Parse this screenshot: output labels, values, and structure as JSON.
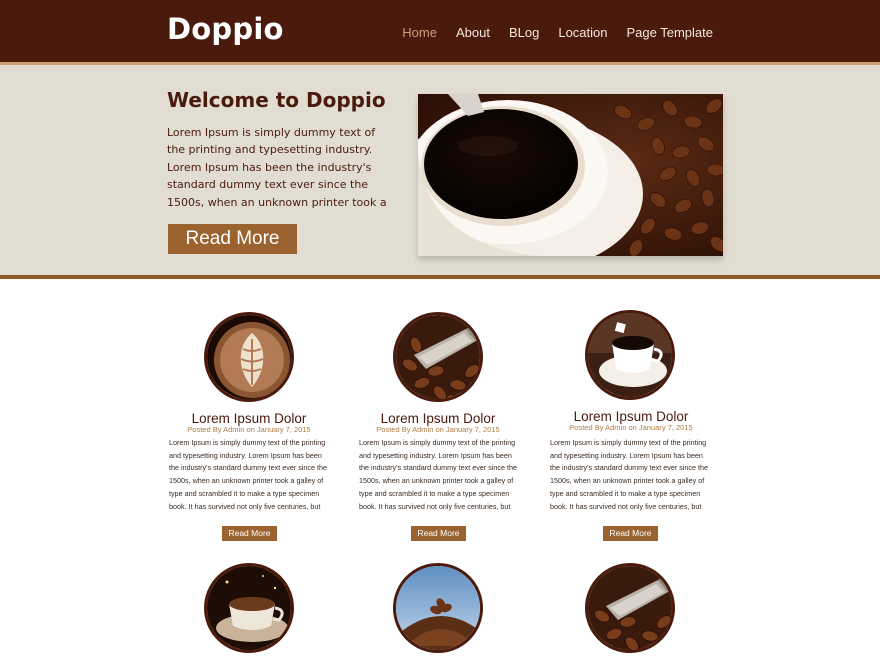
{
  "header": {
    "logo": "Doppio",
    "nav": [
      "Home",
      "About",
      "BLog",
      "Location",
      "Page Template"
    ]
  },
  "hero": {
    "title": "Welcome to Doppio",
    "text": "Lorem Ipsum is simply dummy text of the printing and typesetting industry. Lorem Ipsum has been the industry's standard dummy text ever since the 1500s, when an unknown printer took a galley of type and",
    "button": "Read More"
  },
  "cards": [
    {
      "title": "Lorem Ipsum Dolor",
      "meta": "Posted By Admin on January 7, 2015",
      "text": "Lorem Ipsum is simply dummy text of the printing and typesetting industry. Lorem Ipsum has been the industry's standard dummy text ever since the 1500s, when an unknown printer took a galley of type and scrambled it to make a type specimen book. It has survived not only five centuries, but also the leap into",
      "button": "Read More"
    },
    {
      "title": "Lorem Ipsum Dolor",
      "meta": "Posted By Admin on January 7, 2015",
      "text": "Lorem Ipsum is simply dummy text of the printing and typesetting industry. Lorem Ipsum has been the industry's standard dummy text ever since the 1500s, when an unknown printer took a galley of type and scrambled it to make a type specimen book. It has survived not only five centuries, but also",
      "button": "Read More"
    },
    {
      "title": "Lorem Ipsum Dolor",
      "meta": "Posted By Admin on January 7, 2015",
      "text": "Lorem Ipsum is simply dummy text of the printing and typesetting industry. Lorem Ipsum has been the industry's standard dummy text ever since the 1500s, when an unknown printer took a galley of type and scrambled it to make a type specimen book. It has survived not only five centuries, but also the leap into",
      "button": "Read More"
    }
  ],
  "colors": {
    "header_bg": "#4a1a0c",
    "hero_bg": "#e2ddd3",
    "accent": "#9a6330",
    "nav_active": "#c99f7d"
  },
  "icons": [
    "latte-art-image",
    "coffee-scoop-image",
    "coffee-cup-image",
    "espresso-cup-image",
    "bean-pile-image",
    "bean-scoop-image"
  ]
}
